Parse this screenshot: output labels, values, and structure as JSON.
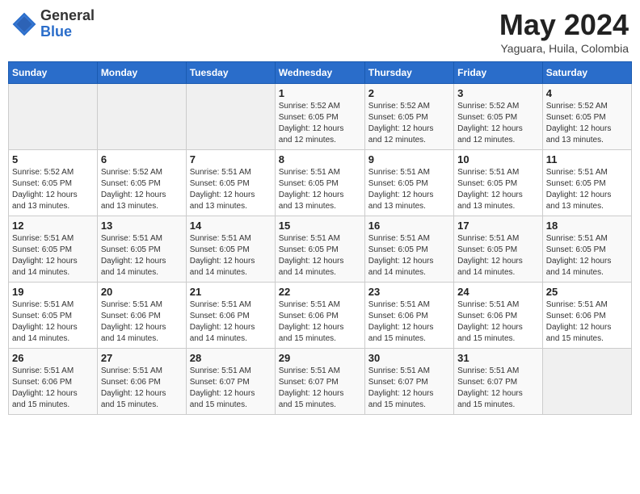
{
  "header": {
    "logo_general": "General",
    "logo_blue": "Blue",
    "month_year": "May 2024",
    "location": "Yaguara, Huila, Colombia"
  },
  "days_of_week": [
    "Sunday",
    "Monday",
    "Tuesday",
    "Wednesday",
    "Thursday",
    "Friday",
    "Saturday"
  ],
  "weeks": [
    [
      {
        "day": "",
        "info": ""
      },
      {
        "day": "",
        "info": ""
      },
      {
        "day": "",
        "info": ""
      },
      {
        "day": "1",
        "info": "Sunrise: 5:52 AM\nSunset: 6:05 PM\nDaylight: 12 hours\nand 12 minutes."
      },
      {
        "day": "2",
        "info": "Sunrise: 5:52 AM\nSunset: 6:05 PM\nDaylight: 12 hours\nand 12 minutes."
      },
      {
        "day": "3",
        "info": "Sunrise: 5:52 AM\nSunset: 6:05 PM\nDaylight: 12 hours\nand 12 minutes."
      },
      {
        "day": "4",
        "info": "Sunrise: 5:52 AM\nSunset: 6:05 PM\nDaylight: 12 hours\nand 13 minutes."
      }
    ],
    [
      {
        "day": "5",
        "info": "Sunrise: 5:52 AM\nSunset: 6:05 PM\nDaylight: 12 hours\nand 13 minutes."
      },
      {
        "day": "6",
        "info": "Sunrise: 5:52 AM\nSunset: 6:05 PM\nDaylight: 12 hours\nand 13 minutes."
      },
      {
        "day": "7",
        "info": "Sunrise: 5:51 AM\nSunset: 6:05 PM\nDaylight: 12 hours\nand 13 minutes."
      },
      {
        "day": "8",
        "info": "Sunrise: 5:51 AM\nSunset: 6:05 PM\nDaylight: 12 hours\nand 13 minutes."
      },
      {
        "day": "9",
        "info": "Sunrise: 5:51 AM\nSunset: 6:05 PM\nDaylight: 12 hours\nand 13 minutes."
      },
      {
        "day": "10",
        "info": "Sunrise: 5:51 AM\nSunset: 6:05 PM\nDaylight: 12 hours\nand 13 minutes."
      },
      {
        "day": "11",
        "info": "Sunrise: 5:51 AM\nSunset: 6:05 PM\nDaylight: 12 hours\nand 13 minutes."
      }
    ],
    [
      {
        "day": "12",
        "info": "Sunrise: 5:51 AM\nSunset: 6:05 PM\nDaylight: 12 hours\nand 14 minutes."
      },
      {
        "day": "13",
        "info": "Sunrise: 5:51 AM\nSunset: 6:05 PM\nDaylight: 12 hours\nand 14 minutes."
      },
      {
        "day": "14",
        "info": "Sunrise: 5:51 AM\nSunset: 6:05 PM\nDaylight: 12 hours\nand 14 minutes."
      },
      {
        "day": "15",
        "info": "Sunrise: 5:51 AM\nSunset: 6:05 PM\nDaylight: 12 hours\nand 14 minutes."
      },
      {
        "day": "16",
        "info": "Sunrise: 5:51 AM\nSunset: 6:05 PM\nDaylight: 12 hours\nand 14 minutes."
      },
      {
        "day": "17",
        "info": "Sunrise: 5:51 AM\nSunset: 6:05 PM\nDaylight: 12 hours\nand 14 minutes."
      },
      {
        "day": "18",
        "info": "Sunrise: 5:51 AM\nSunset: 6:05 PM\nDaylight: 12 hours\nand 14 minutes."
      }
    ],
    [
      {
        "day": "19",
        "info": "Sunrise: 5:51 AM\nSunset: 6:05 PM\nDaylight: 12 hours\nand 14 minutes."
      },
      {
        "day": "20",
        "info": "Sunrise: 5:51 AM\nSunset: 6:06 PM\nDaylight: 12 hours\nand 14 minutes."
      },
      {
        "day": "21",
        "info": "Sunrise: 5:51 AM\nSunset: 6:06 PM\nDaylight: 12 hours\nand 14 minutes."
      },
      {
        "day": "22",
        "info": "Sunrise: 5:51 AM\nSunset: 6:06 PM\nDaylight: 12 hours\nand 15 minutes."
      },
      {
        "day": "23",
        "info": "Sunrise: 5:51 AM\nSunset: 6:06 PM\nDaylight: 12 hours\nand 15 minutes."
      },
      {
        "day": "24",
        "info": "Sunrise: 5:51 AM\nSunset: 6:06 PM\nDaylight: 12 hours\nand 15 minutes."
      },
      {
        "day": "25",
        "info": "Sunrise: 5:51 AM\nSunset: 6:06 PM\nDaylight: 12 hours\nand 15 minutes."
      }
    ],
    [
      {
        "day": "26",
        "info": "Sunrise: 5:51 AM\nSunset: 6:06 PM\nDaylight: 12 hours\nand 15 minutes."
      },
      {
        "day": "27",
        "info": "Sunrise: 5:51 AM\nSunset: 6:06 PM\nDaylight: 12 hours\nand 15 minutes."
      },
      {
        "day": "28",
        "info": "Sunrise: 5:51 AM\nSunset: 6:07 PM\nDaylight: 12 hours\nand 15 minutes."
      },
      {
        "day": "29",
        "info": "Sunrise: 5:51 AM\nSunset: 6:07 PM\nDaylight: 12 hours\nand 15 minutes."
      },
      {
        "day": "30",
        "info": "Sunrise: 5:51 AM\nSunset: 6:07 PM\nDaylight: 12 hours\nand 15 minutes."
      },
      {
        "day": "31",
        "info": "Sunrise: 5:51 AM\nSunset: 6:07 PM\nDaylight: 12 hours\nand 15 minutes."
      },
      {
        "day": "",
        "info": ""
      }
    ]
  ]
}
